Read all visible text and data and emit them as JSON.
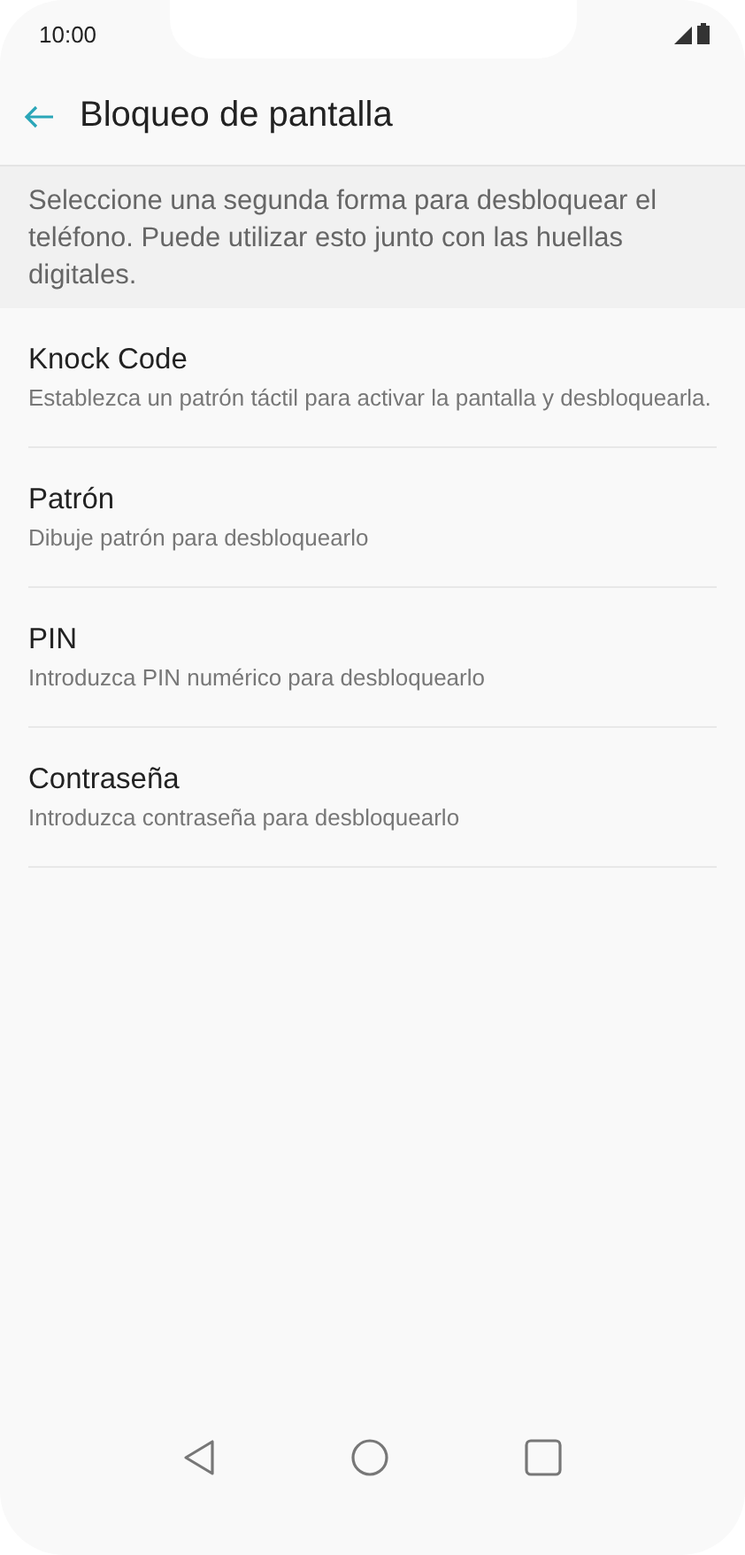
{
  "status_bar": {
    "time": "10:00"
  },
  "header": {
    "title": "Bloqueo de pantalla"
  },
  "description": "Seleccione una segunda forma para desbloquear el teléfono. Puede utilizar esto junto con las huellas digitales.",
  "options": [
    {
      "title": "Knock Code",
      "subtitle": "Establezca un patrón táctil para activar la pantalla y desbloquearla."
    },
    {
      "title": "Patrón",
      "subtitle": "Dibuje patrón para desbloquearlo"
    },
    {
      "title": "PIN",
      "subtitle": "Introduzca PIN numérico para desbloquearlo"
    },
    {
      "title": "Contraseña",
      "subtitle": "Introduzca contraseña para desbloquearlo"
    }
  ]
}
